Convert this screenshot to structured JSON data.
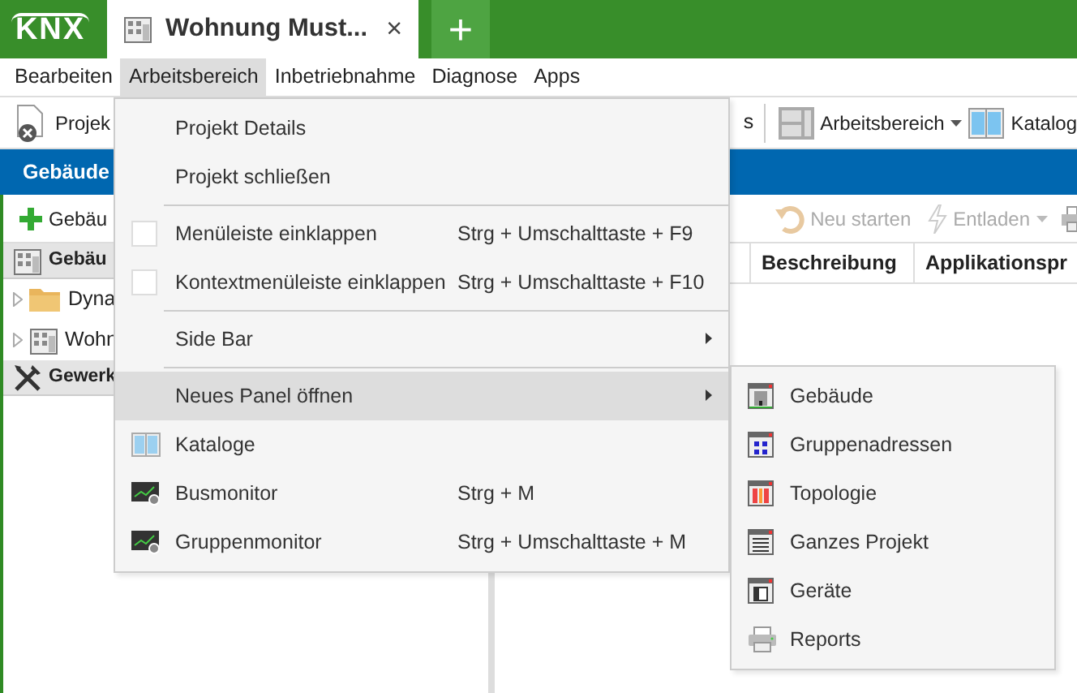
{
  "app_bar": {
    "logo": "KNX",
    "tabs": [
      {
        "title": "Wohnung Must...",
        "close": "×",
        "selected": true
      }
    ],
    "add_tab": "+"
  },
  "menu_bar": {
    "items": [
      {
        "label": "Bearbeiten",
        "selected": false
      },
      {
        "label": "Arbeitsbereich",
        "selected": true
      },
      {
        "label": "Inbetriebnahme",
        "selected": false
      },
      {
        "label": "Diagnose",
        "selected": false
      },
      {
        "label": "Apps",
        "selected": false
      }
    ]
  },
  "toolbar": {
    "left_items": [
      {
        "label": "Projek"
      }
    ],
    "right_items": [
      {
        "label": "s"
      },
      {
        "label": "Arbeitsbereich",
        "caret": true
      },
      {
        "label": "Katalog"
      }
    ]
  },
  "panel_bar": {
    "title": "Gebäude"
  },
  "left_panel": {
    "toolbar": {
      "label": "Gebäu"
    },
    "sections": [
      {
        "title": "Gebäu",
        "children": [
          {
            "label": "Dyna"
          },
          {
            "label": "Wohn"
          }
        ]
      },
      {
        "title": "Gewerk"
      }
    ]
  },
  "right_panel": {
    "toolbar": [
      {
        "label": "Neu starten",
        "disabled": true,
        "caret": false
      },
      {
        "label": "Entladen",
        "disabled": true,
        "caret": true
      }
    ],
    "table": {
      "columns": [
        "Beschreibung",
        "Applikationspr"
      ]
    }
  },
  "menu": {
    "items": [
      {
        "kind": "action",
        "label": "Projekt Details",
        "selected": false
      },
      {
        "kind": "action",
        "label": "Projekt schließen",
        "selected": false
      },
      {
        "kind": "separator"
      },
      {
        "kind": "check",
        "label": "Menüleiste einklappen",
        "checked": false,
        "shortcut": "Strg + Umschalttaste + F9",
        "selected": false
      },
      {
        "kind": "check",
        "label": "Kontextmenüleiste einklappen",
        "checked": false,
        "shortcut": "Strg + Umschalttaste + F10",
        "selected": false
      },
      {
        "kind": "separator"
      },
      {
        "kind": "submenu",
        "label": "Side Bar",
        "selected": false
      },
      {
        "kind": "separator"
      },
      {
        "kind": "submenu",
        "label": "Neues Panel öffnen",
        "selected": true
      },
      {
        "kind": "action",
        "label": "Kataloge",
        "selected": false
      },
      {
        "kind": "action",
        "label": "Busmonitor",
        "shortcut": "Strg + M",
        "selected": false
      },
      {
        "kind": "action",
        "label": "Gruppenmonitor",
        "shortcut": "Strg + Umschalttaste + M",
        "selected": false
      }
    ]
  },
  "submenu": {
    "items": [
      {
        "label": "Gebäude",
        "selected": false
      },
      {
        "label": "Gruppenadressen",
        "selected": false
      },
      {
        "label": "Topologie",
        "selected": false
      },
      {
        "label": "Ganzes Projekt",
        "selected": false
      },
      {
        "label": "Geräte",
        "selected": false
      },
      {
        "label": "Reports",
        "selected": false
      }
    ]
  }
}
